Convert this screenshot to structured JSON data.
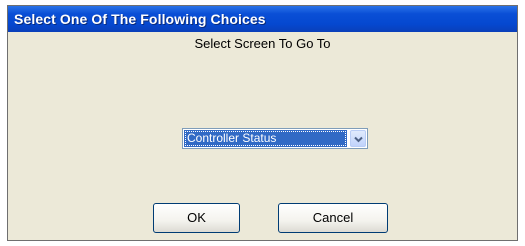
{
  "window": {
    "title": "Select One Of The Following Choices"
  },
  "prompt": {
    "heading": "Select Screen To Go To"
  },
  "screen_select": {
    "selected_value": "Controller Status",
    "dropdown_icon": "chevron-down-icon"
  },
  "buttons": {
    "ok_label": "OK",
    "cancel_label": "Cancel"
  },
  "colors": {
    "titlebar": "#0548d0",
    "dialog_background": "#ece9d8",
    "selection_highlight": "#316ac5"
  }
}
